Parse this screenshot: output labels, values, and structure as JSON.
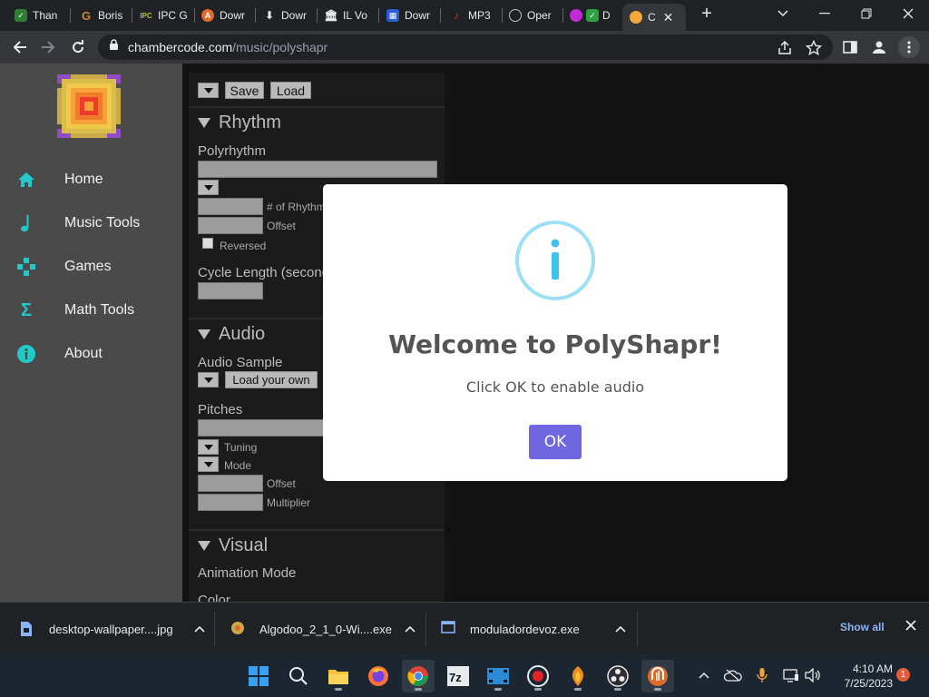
{
  "browser": {
    "tabs": [
      {
        "label": "Than",
        "icon": "check-icon",
        "color": "#2e7d32"
      },
      {
        "label": "Boris",
        "icon": "g-icon",
        "color": "#c28b2b"
      },
      {
        "label": "IPC G",
        "icon": "ipc-icon",
        "color": "#4a6b2a"
      },
      {
        "label": "Dowr",
        "icon": "download-site-icon",
        "color": "#e06a2b"
      },
      {
        "label": "Dowr",
        "icon": "download-arrow-icon",
        "color": "#5f6368"
      },
      {
        "label": "IL Vo",
        "icon": "building-icon",
        "color": "#5f6368"
      },
      {
        "label": "Dowr",
        "icon": "grid-icon",
        "color": "#2b5bd6"
      },
      {
        "label": "MP3",
        "icon": "mp3-icon",
        "color": "#d62b2b"
      },
      {
        "label": "Oper",
        "icon": "chatgpt-icon",
        "color": "#8a8a8a"
      },
      {
        "label": "D",
        "icon": "dual-icon",
        "color": "#c02bd6"
      },
      {
        "label": "C",
        "icon": "circle-icon",
        "color": "#f2a93b"
      }
    ],
    "new_tab_label": "+",
    "url_host": "chambercode.com",
    "url_path": "/music/polyshapr"
  },
  "sidebar": {
    "items": [
      {
        "label": "Home",
        "icon": "home-icon"
      },
      {
        "label": "Music Tools",
        "icon": "music-note-icon"
      },
      {
        "label": "Games",
        "icon": "gamepad-icon"
      },
      {
        "label": "Math Tools",
        "icon": "sigma-icon"
      },
      {
        "label": "About",
        "icon": "info-icon"
      }
    ],
    "accent": "#21c9c9"
  },
  "controls": {
    "save_label": "Save",
    "load_label": "Load",
    "rhythm": {
      "heading": "Rhythm",
      "polyrhythm_label": "Polyrhythm",
      "num_rhythms_label": "# of Rhythms",
      "offset_label": "Offset",
      "reversed_label": "Reversed",
      "cycle_length_label": "Cycle Length (seconds)"
    },
    "audio": {
      "heading": "Audio",
      "sample_label": "Audio Sample",
      "load_own_label": "Load your own",
      "pitches_label": "Pitches",
      "tuning_label": "Tuning",
      "mode_label": "Mode",
      "offset_label": "Offset",
      "multiplier_label": "Multiplier"
    },
    "visual": {
      "heading": "Visual",
      "animation_mode_label": "Animation Mode",
      "color_label": "Color"
    }
  },
  "modal": {
    "title": "Welcome to PolyShapr!",
    "text": "Click OK to enable audio",
    "ok_label": "OK",
    "button_color": "#7066e0",
    "icon_color": "#9de0f6"
  },
  "downloads": {
    "items": [
      {
        "name": "desktop-wallpaper....jpg",
        "icon": "image-file-icon"
      },
      {
        "name": "Algodoo_2_1_0-Wi....exe",
        "icon": "algodoo-icon"
      },
      {
        "name": "moduladordevoz.exe",
        "icon": "exe-file-icon"
      }
    ],
    "show_all_label": "Show all"
  },
  "taskbar": {
    "time": "4:10 AM",
    "date": "7/25/2023",
    "notification_count": "1"
  }
}
